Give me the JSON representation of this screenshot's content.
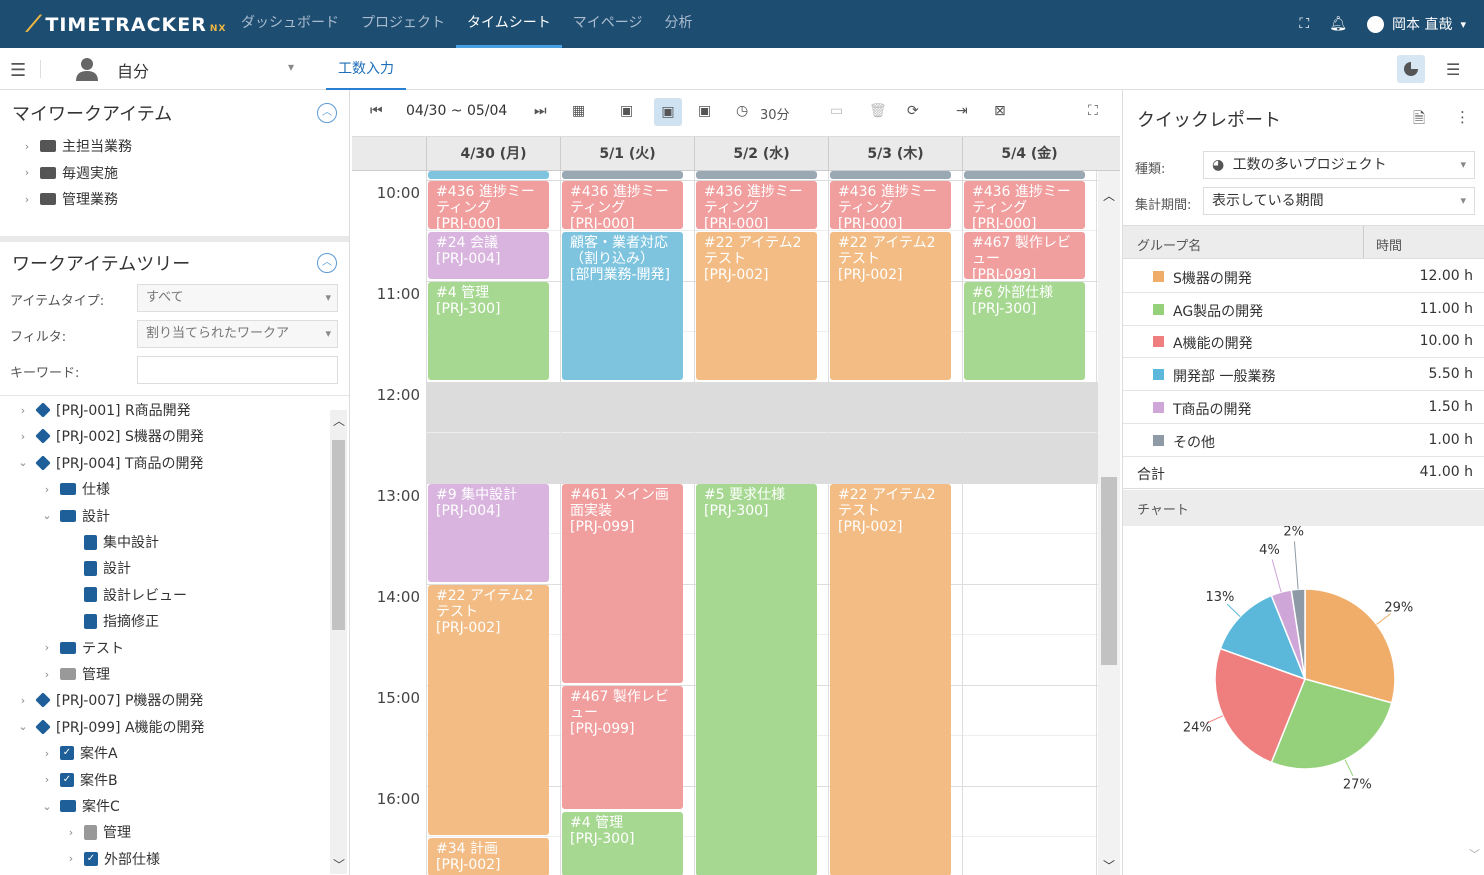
{
  "app": {
    "logo": "TIMETRACKER",
    "logo_suffix": "NX"
  },
  "nav": [
    "ダッシュボード",
    "プロジェクト",
    "タイムシート",
    "マイページ",
    "分析"
  ],
  "nav_active": 2,
  "user": {
    "name": "岡本 直哉"
  },
  "subbar": {
    "owner": "自分",
    "tab": "工数入力"
  },
  "my_work": {
    "title": "マイワークアイテム",
    "items": [
      "主担当業務",
      "毎週実施",
      "管理業務"
    ]
  },
  "tree_panel": {
    "title": "ワークアイテムツリー",
    "item_type_label": "アイテムタイプ:",
    "item_type_value": "すべて",
    "filter_label": "フィルタ:",
    "filter_value": "割り当てられたワークア",
    "keyword_label": "キーワード:",
    "keyword_value": "",
    "nodes": [
      {
        "label": "[PRJ-001] R商品開発",
        "level": 0,
        "icon": "cube",
        "exp": "right"
      },
      {
        "label": "[PRJ-002] S機器の開発",
        "level": 0,
        "icon": "cube",
        "exp": "right"
      },
      {
        "label": "[PRJ-004] T商品の開発",
        "level": 0,
        "icon": "cube",
        "exp": "down"
      },
      {
        "label": "仕様",
        "level": 1,
        "icon": "folder",
        "exp": "right"
      },
      {
        "label": "設計",
        "level": 1,
        "icon": "folder",
        "exp": "down"
      },
      {
        "label": "集中設計",
        "level": 2,
        "icon": "clip",
        "exp": ""
      },
      {
        "label": "設計",
        "level": 2,
        "icon": "clip",
        "exp": ""
      },
      {
        "label": "設計レビュー",
        "level": 2,
        "icon": "clip",
        "exp": ""
      },
      {
        "label": "指摘修正",
        "level": 2,
        "icon": "clip",
        "exp": ""
      },
      {
        "label": "テスト",
        "level": 1,
        "icon": "folder",
        "exp": "right"
      },
      {
        "label": "管理",
        "level": 1,
        "icon": "folder-gray",
        "exp": "right"
      },
      {
        "label": "[PRJ-007] P機器の開発",
        "level": 0,
        "icon": "cube",
        "exp": "right"
      },
      {
        "label": "[PRJ-099] A機能の開発",
        "level": 0,
        "icon": "cube",
        "exp": "down"
      },
      {
        "label": "案件A",
        "level": 1,
        "icon": "check",
        "exp": "right"
      },
      {
        "label": "案件B",
        "level": 1,
        "icon": "check",
        "exp": "right"
      },
      {
        "label": "案件C",
        "level": 1,
        "icon": "folder",
        "exp": "down"
      },
      {
        "label": "管理",
        "level": 2,
        "icon": "clip-gray",
        "exp": "right"
      },
      {
        "label": "外部仕様",
        "level": 2,
        "icon": "check",
        "exp": "right"
      }
    ]
  },
  "toolbar": {
    "range": "04/30 ~ 05/04",
    "interval": "30分"
  },
  "calendar": {
    "days": [
      "4/30 (月)",
      "5/1 (火)",
      "5/2 (水)",
      "5/3 (木)",
      "5/4 (金)"
    ],
    "times": [
      "10:00",
      "11:00",
      "12:00",
      "13:00",
      "14:00",
      "15:00",
      "16:00"
    ],
    "events": [
      {
        "day": 0,
        "start": 10.0,
        "end": 10.5,
        "title": "#436 進捗ミーティング",
        "code": "[PRJ-000]",
        "color": "red"
      },
      {
        "day": 1,
        "start": 10.0,
        "end": 10.5,
        "title": "#436 進捗ミーティング",
        "code": "[PRJ-000]",
        "color": "red"
      },
      {
        "day": 2,
        "start": 10.0,
        "end": 10.5,
        "title": "#436 進捗ミーティング",
        "code": "[PRJ-000]",
        "color": "red"
      },
      {
        "day": 3,
        "start": 10.0,
        "end": 10.5,
        "title": "#436 進捗ミーティング",
        "code": "[PRJ-000]",
        "color": "red"
      },
      {
        "day": 4,
        "start": 10.0,
        "end": 10.5,
        "title": "#436 進捗ミーティング",
        "code": "[PRJ-000]",
        "color": "red"
      },
      {
        "day": 0,
        "start": 10.5,
        "end": 11.0,
        "title": "#24 会議",
        "code": "[PRJ-004]",
        "color": "purple"
      },
      {
        "day": 1,
        "start": 10.5,
        "end": 12.0,
        "title": "顧客・業者対応（割り込み）",
        "code": "[部門業務-開発]",
        "color": "blue"
      },
      {
        "day": 2,
        "start": 10.5,
        "end": 12.0,
        "title": "#22 アイテム2テスト",
        "code": "[PRJ-002]",
        "color": "orange"
      },
      {
        "day": 3,
        "start": 10.5,
        "end": 12.0,
        "title": "#22 アイテム2テスト",
        "code": "[PRJ-002]",
        "color": "orange"
      },
      {
        "day": 4,
        "start": 10.5,
        "end": 11.0,
        "title": "#467 製作レビュー",
        "code": "[PRJ-099]",
        "color": "red"
      },
      {
        "day": 0,
        "start": 11.0,
        "end": 12.0,
        "title": "#4 管理",
        "code": "[PRJ-300]",
        "color": "green"
      },
      {
        "day": 4,
        "start": 11.0,
        "end": 12.0,
        "title": "#6 外部仕様",
        "code": "[PRJ-300]",
        "color": "green"
      },
      {
        "day": 0,
        "start": 13.0,
        "end": 14.0,
        "title": "#9 集中設計",
        "code": "[PRJ-004]",
        "color": "purple"
      },
      {
        "day": 1,
        "start": 13.0,
        "end": 15.0,
        "title": "#461 メイン画面実装",
        "code": "[PRJ-099]",
        "color": "red"
      },
      {
        "day": 2,
        "start": 13.0,
        "end": 17.0,
        "title": "#5 要求仕様",
        "code": "[PRJ-300]",
        "color": "green"
      },
      {
        "day": 3,
        "start": 13.0,
        "end": 17.0,
        "title": "#22 アイテム2テスト",
        "code": "[PRJ-002]",
        "color": "orange"
      },
      {
        "day": 0,
        "start": 14.0,
        "end": 16.5,
        "title": "#22 アイテム2テスト",
        "code": "[PRJ-002]",
        "color": "orange"
      },
      {
        "day": 1,
        "start": 15.0,
        "end": 16.25,
        "title": "#467 製作レビュー",
        "code": "[PRJ-099]",
        "color": "red"
      },
      {
        "day": 1,
        "start": 16.25,
        "end": 17.0,
        "title": "#4 管理",
        "code": "[PRJ-300]",
        "color": "green"
      },
      {
        "day": 0,
        "start": 16.5,
        "end": 17.0,
        "title": "#34 計画",
        "code": "[PRJ-002]",
        "color": "orange"
      }
    ]
  },
  "quick_report": {
    "title": "クイックレポート",
    "type_label": "種類:",
    "type_value": "工数の多いプロジェクト",
    "period_label": "集計期間:",
    "period_value": "表示している期間",
    "col_group": "グループ名",
    "col_time": "時間",
    "rows": [
      {
        "name": "S機器の開発",
        "value": "12.00 h",
        "color": "#f0ad6a"
      },
      {
        "name": "AG製品の開発",
        "value": "11.00 h",
        "color": "#95d17a"
      },
      {
        "name": "A機能の開発",
        "value": "10.00 h",
        "color": "#ef7f7f"
      },
      {
        "name": "開発部 一般業務",
        "value": "5.50 h",
        "color": "#5bb8da"
      },
      {
        "name": "T商品の開発",
        "value": "1.50 h",
        "color": "#cfa6d8"
      },
      {
        "name": "その他",
        "value": "1.00 h",
        "color": "#8e9ba6"
      }
    ],
    "total_label": "合計",
    "total_value": "41.00 h",
    "chart_label": "チャート"
  },
  "chart_data": {
    "type": "pie",
    "labels": [
      "29%",
      "27%",
      "24%",
      "13%",
      "4%",
      "2%"
    ],
    "values": [
      12.0,
      11.0,
      10.0,
      5.5,
      1.5,
      1.0
    ],
    "colors": [
      "#f0ad6a",
      "#95d17a",
      "#ef7f7f",
      "#5bb8da",
      "#cfa6d8",
      "#8e9ba6"
    ]
  }
}
